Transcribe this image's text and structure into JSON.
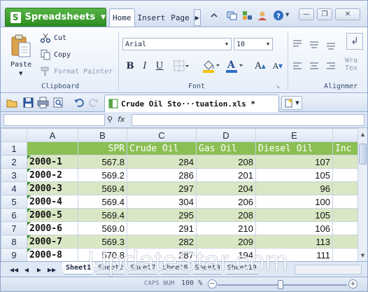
{
  "app": {
    "name": "Spreadsheets"
  },
  "menu_tabs": [
    {
      "label": "Home"
    },
    {
      "label": "Insert"
    },
    {
      "label": "Page"
    }
  ],
  "ribbon": {
    "clipboard": {
      "paste": "Paste",
      "cut": "Cut",
      "copy": "Copy",
      "format_painter": "Format Painter",
      "group": "Clipboard"
    },
    "font": {
      "name": "Arial",
      "size": "10",
      "bold": "B",
      "italic": "I",
      "underline": "U",
      "grow": "A",
      "shrink": "A",
      "group": "Font"
    },
    "alignment": {
      "wrap": "Wra",
      "wrap2": "Tex",
      "group": "Alignmer"
    }
  },
  "document": {
    "tab_title": "Crude Oil Sto···tuation.xls *"
  },
  "grid": {
    "columns": [
      "A",
      "B",
      "C",
      "D",
      "E",
      ""
    ],
    "header_row": {
      "row": "1",
      "cells": [
        "",
        "SPR",
        "Crude Oil",
        "Gas Oil",
        "Diesel Oil",
        "Inc"
      ]
    },
    "rows": [
      {
        "row": "2",
        "year": "2000-1",
        "spr": "567.8",
        "crude": "284",
        "gas": "208",
        "diesel": "107"
      },
      {
        "row": "3",
        "year": "2000-2",
        "spr": "569.2",
        "crude": "286",
        "gas": "201",
        "diesel": "105"
      },
      {
        "row": "4",
        "year": "2000-3",
        "spr": "569.4",
        "crude": "297",
        "gas": "204",
        "diesel": "96"
      },
      {
        "row": "5",
        "year": "2000-4",
        "spr": "569.4",
        "crude": "304",
        "gas": "206",
        "diesel": "100"
      },
      {
        "row": "6",
        "year": "2000-5",
        "spr": "569.4",
        "crude": "295",
        "gas": "208",
        "diesel": "105"
      },
      {
        "row": "7",
        "year": "2000-6",
        "spr": "569.0",
        "crude": "291",
        "gas": "210",
        "diesel": "106"
      },
      {
        "row": "8",
        "year": "2000-7",
        "spr": "569.3",
        "crude": "282",
        "gas": "209",
        "diesel": "113"
      },
      {
        "row": "9",
        "year": "2000-8",
        "spr": "570.8",
        "crude": "287",
        "gas": "194",
        "diesel": "111"
      }
    ]
  },
  "sheets": [
    "Sheet1",
    "Sheet2",
    "Sheet7",
    "Sheet8",
    "Sheet9",
    "Sheet10"
  ],
  "status": {
    "caps": "CAPS NUM",
    "zoom": "100 %",
    "minus": "−",
    "plus": "+"
  },
  "watermark": "UpdateStar.com",
  "colors": {
    "accent_green": "#8cbf53",
    "band_green": "#d9e7c4",
    "app_green": "#2e8d22"
  }
}
